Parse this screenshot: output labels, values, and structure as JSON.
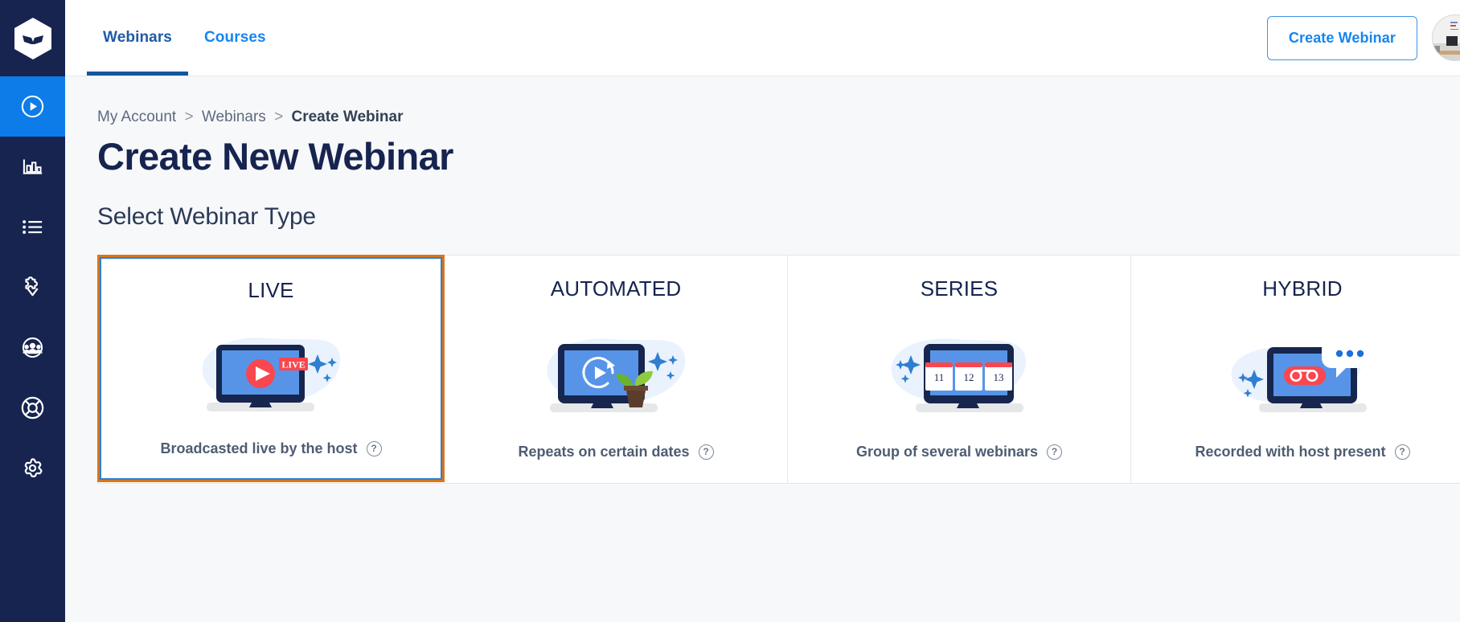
{
  "sidebar": {
    "logo": "mask-logo-icon",
    "items": [
      {
        "name": "broadcast",
        "icon": "play-circle-icon",
        "active": true
      },
      {
        "name": "analytics",
        "icon": "bar-chart-icon",
        "active": false
      },
      {
        "name": "list",
        "icon": "list-icon",
        "active": false
      },
      {
        "name": "integrations",
        "icon": "puzzle-icon",
        "active": false
      },
      {
        "name": "contacts",
        "icon": "users-icon",
        "active": false
      },
      {
        "name": "support",
        "icon": "life-ring-icon",
        "active": false
      },
      {
        "name": "settings",
        "icon": "gear-icon",
        "active": false
      }
    ]
  },
  "header": {
    "tabs": [
      {
        "label": "Webinars",
        "active": true
      },
      {
        "label": "Courses",
        "active": false
      }
    ],
    "create_button": "Create Webinar",
    "avatar_alt": "user-avatar"
  },
  "breadcrumb": {
    "items": [
      "My Account",
      "Webinars",
      "Create Webinar"
    ],
    "separator": ">"
  },
  "page": {
    "title": "Create New Webinar",
    "section_title": "Select Webinar Type"
  },
  "colors": {
    "sidebar_bg": "#16244f",
    "sidebar_active": "#0d7ce8",
    "tab_active": "#1e5aa8",
    "tab_inactive": "#1785ef",
    "accent_blue": "#1785ef",
    "selected_border": "#d9761a",
    "focus_outline": "#2f7fd1",
    "page_bg": "#f7f8fa",
    "title_navy": "#16244f",
    "art_red": "#f9474f",
    "art_blue": "#5794e8",
    "art_navy": "#17264e"
  },
  "webinar_types": [
    {
      "id": "live",
      "title": "LIVE",
      "description": "Broadcasted live by the host",
      "help": "?",
      "selected": true,
      "art": "laptop-live-play-icon"
    },
    {
      "id": "automated",
      "title": "AUTOMATED",
      "description": "Repeats on certain dates",
      "help": "?",
      "selected": false,
      "art": "laptop-replay-plant-icon"
    },
    {
      "id": "series",
      "title": "SERIES",
      "description": "Group of several webinars",
      "help": "?",
      "selected": false,
      "art": "laptop-calendar-icon",
      "calendar_days": [
        "11",
        "12",
        "13"
      ]
    },
    {
      "id": "hybrid",
      "title": "HYBRID",
      "description": "Recorded with host present",
      "help": "?",
      "selected": false,
      "art": "laptop-recording-chat-icon"
    }
  ]
}
